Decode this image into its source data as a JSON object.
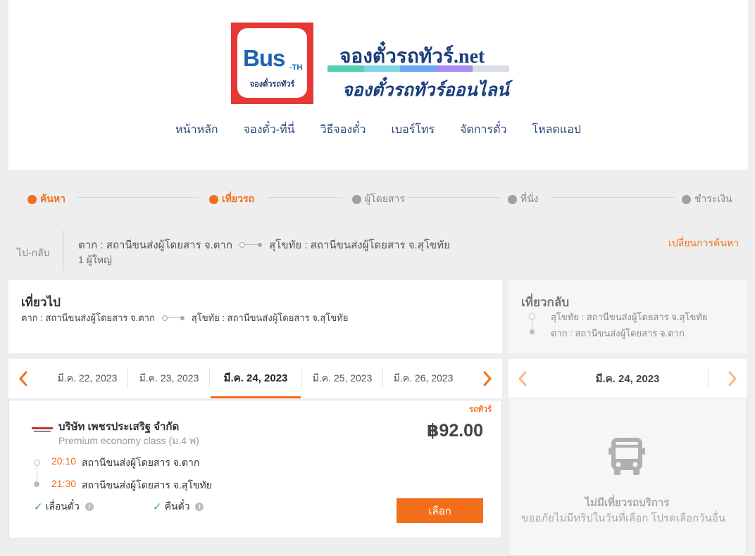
{
  "brand": {
    "logo_text": "Bus",
    "logo_suffix": "-TH",
    "logo_sub": "จองตั๋วรถทัวร์",
    "site_title": "จองตั๋วรถทัวร์.net",
    "site_subtitle": "จองตั๋วรถทัวร์ออนไลน์",
    "bar_colors": [
      "#4fd1b2",
      "#7fd6e6",
      "#6ba8f0",
      "#a78bf0",
      "#d8dde6"
    ]
  },
  "nav": [
    "หน้าหลัก",
    "จองตั๋ว-ที่นี่",
    "วิธีจองตั๋ว",
    "เบอร์โทร",
    "จัดการตั๋ว",
    "โหลดแอป"
  ],
  "steps": [
    {
      "label": "ค้นหา",
      "active": true
    },
    {
      "label": "เที่ยวรถ",
      "active": true
    },
    {
      "label": "ผู้โดยสาร",
      "active": false
    },
    {
      "label": "ที่นั่ง",
      "active": false
    },
    {
      "label": "ชำระเงิน",
      "active": false
    }
  ],
  "summary": {
    "trip_type": "ไป-กลับ",
    "from": "ตาก : สถานีขนส่งผู้โดยสาร จ.ตาก",
    "to": "สุโขทัย : สถานีขนส่งผู้โดยสาร จ.สุโขทัย",
    "passengers": "1 ผู้ใหญ่",
    "change_search": "เปลี่ยนการค้นหา"
  },
  "outbound": {
    "title": "เที่ยวไป",
    "from": "ตาก : สถานีขนส่งผู้โดยสาร จ.ตาก",
    "to": "สุโขทัย : สถานีขนส่งผู้โดยสาร จ.สุโขทัย",
    "dates": [
      "มี.ค. 22, 2023",
      "มี.ค. 23, 2023",
      "มี.ค. 24, 2023",
      "มี.ค. 25, 2023",
      "มี.ค. 26, 2023"
    ],
    "selected_date_index": 2
  },
  "return": {
    "title": "เที่ยวกลับ",
    "from": "สุโขทัย : สถานีขนส่งผู้โดยสาร จ.สุโขทัย",
    "to": "ตาก : สถานีขนส่งผู้โดยสาร จ.ตาก",
    "date": "มี.ค. 24, 2023",
    "empty_title": "ไม่มีเที่ยวรถบริการ",
    "empty_message": "ขออภัยไม่มีทริปในวันที่เลือก โปรดเลือกวันอื่น"
  },
  "trip": {
    "tag": "รถทัวร์",
    "operator": "บริษัท เพชรประเสริฐ จำกัด",
    "bus_class": "Premium economy class (ม.4 พ)",
    "price": "฿92.00",
    "depart_time": "20:10",
    "depart_station": "สถานีขนส่งผู้โดยสาร จ.ตาก",
    "arrive_time": "21:30",
    "arrive_station": "สถานีขนส่งผู้โดยสาร จ.สุโขทัย",
    "feature_1": "เลื่อนตั๋ว",
    "feature_2": "คืนตั๋ว",
    "select_label": "เลือก"
  },
  "colors": {
    "accent": "#f36f1b",
    "inactive_dot": "#a0a0a0",
    "check": "#3fae49"
  }
}
